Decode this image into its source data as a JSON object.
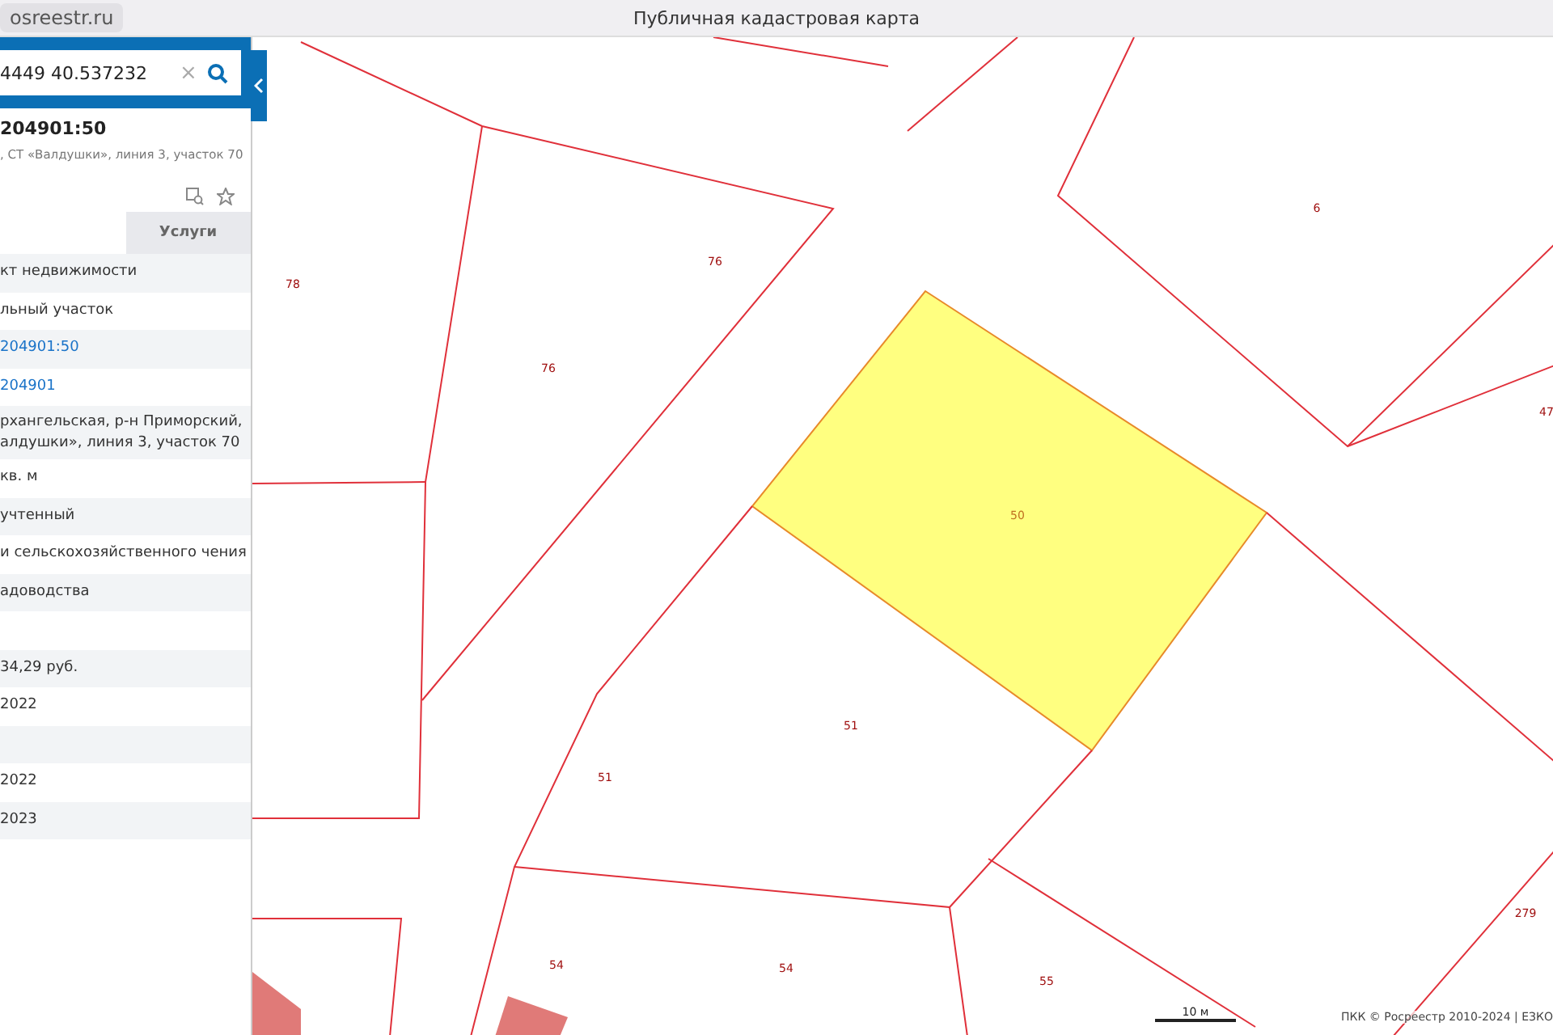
{
  "browser": {
    "url": "osreestr.ru",
    "title": "Публичная кадастровая карта"
  },
  "search": {
    "value": "4449 40.537232",
    "clear": "×"
  },
  "object": {
    "title": "204901:50",
    "subtitle": ", СТ «Валдушки», линия 3, участок 70"
  },
  "tabs": [
    {
      "selected": true
    },
    {
      "label": "Услуги",
      "selected": false
    }
  ],
  "rows": [
    {
      "kind": "text",
      "text": "кт недвижимости"
    },
    {
      "kind": "text",
      "text": "льный участок"
    },
    {
      "kind": "link",
      "text": "204901:50"
    },
    {
      "kind": "link",
      "text": "204901"
    },
    {
      "kind": "text",
      "text": "рхангельская, р-н Приморский, алдушки», линия 3, участок 70"
    },
    {
      "kind": "text",
      "text": "кв. м"
    },
    {
      "kind": "text",
      "text": " учтенный"
    },
    {
      "kind": "text",
      "text": "и сельскохозяйственного чения"
    },
    {
      "kind": "text",
      "text": "адоводства"
    },
    {
      "kind": "blank"
    },
    {
      "kind": "text",
      "text": "34,29 руб."
    },
    {
      "kind": "text",
      "text": "2022"
    },
    {
      "kind": "blank"
    },
    {
      "kind": "text",
      "text": "2022"
    },
    {
      "kind": "text",
      "text": "2023"
    }
  ],
  "parcels": [
    {
      "label": "78",
      "selected": false
    },
    {
      "label": "76",
      "selected": false
    },
    {
      "label": "76",
      "selected": false
    },
    {
      "label": "6",
      "selected": false
    },
    {
      "label": "47",
      "selected": false
    },
    {
      "label": "50",
      "selected": true
    },
    {
      "label": "51",
      "selected": false
    },
    {
      "label": "51",
      "selected": false
    },
    {
      "label": "54",
      "selected": false
    },
    {
      "label": "54",
      "selected": false
    },
    {
      "label": "55",
      "selected": false
    },
    {
      "label": "279",
      "selected": false
    }
  ],
  "scale": "10 м",
  "attribution": "ПКК © Росреестр 2010-2024 | ЕЗКО"
}
